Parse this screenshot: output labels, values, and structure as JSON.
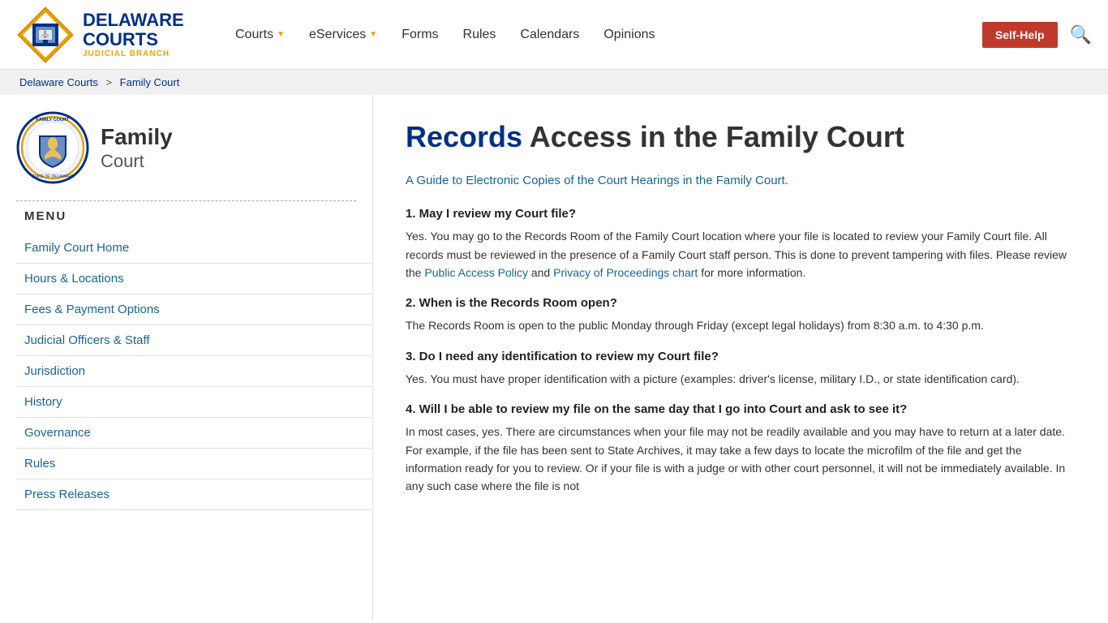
{
  "header": {
    "org_line1": "DELAWARE",
    "org_line2": "COURTS",
    "org_line3": "JUDICIAL BRANCH",
    "nav_items": [
      {
        "label": "Courts",
        "has_dropdown": true
      },
      {
        "label": "eServices",
        "has_dropdown": true
      },
      {
        "label": "Forms",
        "has_dropdown": false
      },
      {
        "label": "Rules",
        "has_dropdown": false
      },
      {
        "label": "Calendars",
        "has_dropdown": false
      },
      {
        "label": "Opinions",
        "has_dropdown": false
      }
    ],
    "self_help_label": "Self-Help"
  },
  "breadcrumb": {
    "items": [
      "Delaware Courts",
      "Family Court"
    ],
    "separator": ">"
  },
  "sidebar": {
    "court_name_bold": "Family",
    "court_name_sub": "Court",
    "menu_label": "MENU",
    "menu_items": [
      "Family Court Home",
      "Hours & Locations",
      "Fees & Payment Options",
      "Judicial Officers & Staff",
      "Jurisdiction",
      "History",
      "Governance",
      "Rules",
      "Press Releases"
    ]
  },
  "content": {
    "title_bold": "Records",
    "title_rest": " Access in the Family Court",
    "subtitle": "A Guide to Electronic Copies of the Court Hearings in the Family Court.",
    "faqs": [
      {
        "question": "1. May I review my Court file?",
        "answer": "Yes.  You may go to the Records Room of the Family Court location where your file is located to review your Family Court file.  All records must be reviewed in the presence of a Family Court staff person.  This is done to prevent tampering with files. Please review the Public Access Policy and Privacy of Proceedings chart for more information."
      },
      {
        "question": "2. When is the Records Room open?",
        "answer": "The Records Room is open to the public Monday through Friday (except legal holidays) from 8:30 a.m. to 4:30 p.m."
      },
      {
        "question": "3. Do I need any identification to review my Court file?",
        "answer": "Yes.  You must have proper identification with a picture (examples:  driver's license, military I.D., or state identification card)."
      },
      {
        "question": "4. Will I be able to review my file on the same day that I go into Court and ask to see it?",
        "answer": "In most cases, yes.  There are circumstances when your file may not be readily available and you may have to return at a later date.  For example, if the file has been sent to State Archives, it may take a few days to locate the microfilm of the file and get the information ready for you to review.  Or if your file is with a judge or with other court personnel, it will not be immediately available.  In any such case where the file is not"
      }
    ]
  }
}
